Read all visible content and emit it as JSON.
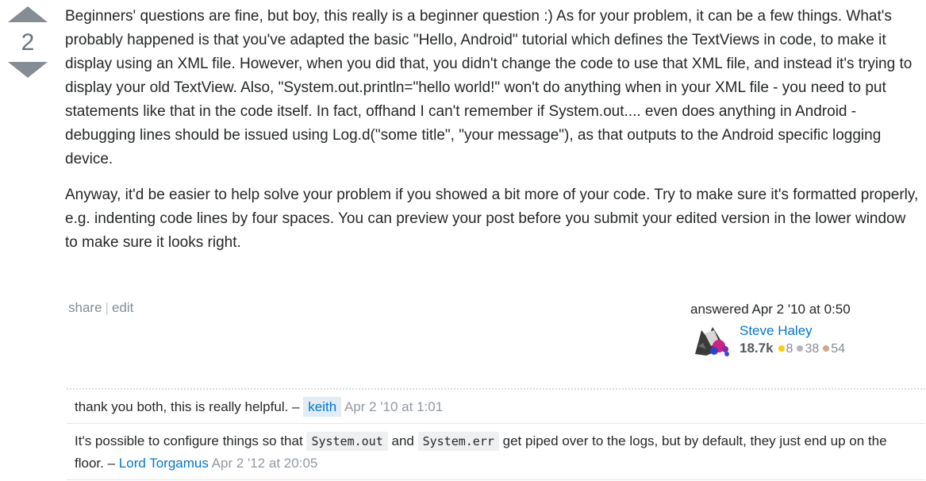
{
  "vote": {
    "count": "2"
  },
  "answer": {
    "paragraphs": [
      "Beginners' questions are fine, but boy, this really is a beginner question :) As for your problem, it can be a few things. What's probably happened is that you've adapted the basic \"Hello, Android\" tutorial which defines the TextViews in code, to make it display using an XML file. However, when you did that, you didn't change the code to use that XML file, and instead it's trying to display your old TextView. Also, \"System.out.println=\"hello world!\" won't do anything when in your XML file - you need to put statements like that in the code itself. In fact, offhand I can't remember if System.out.... even does anything in Android - debugging lines should be issued using Log.d(\"some title\", \"your message\"), as that outputs to the Android specific logging device.",
      "Anyway, it'd be easier to help solve your problem if you showed a bit more of your code. Try to make sure it's formatted properly, e.g. indenting code lines by four spaces. You can preview your post before you submit your edited version in the lower window to make sure it looks right."
    ]
  },
  "post_menu": {
    "share": "share",
    "separator": "|",
    "edit": "edit"
  },
  "user": {
    "action_time": "answered Apr 2 '10 at 0:50",
    "name": "Steve Haley",
    "reputation": "18.7k",
    "gold": "8",
    "silver": "38",
    "bronze": "54"
  },
  "comments": [
    {
      "text": "thank you both, this is really helpful. –",
      "user": "keith",
      "date": "Apr 2 '10 at 1:01"
    },
    {
      "text_1": "It's possible to configure things so that",
      "code_1": "System.out",
      "text_2": "and",
      "code_2": "System.err",
      "text_3": "get piped over to the logs, but by default, they just end up on the floor. –",
      "user": "Lord Torgamus",
      "date": "Apr 2 '12 at 20:05"
    }
  ],
  "colors": {
    "link": "#0077cc",
    "gold": "#ffcc01",
    "silver": "#b4b8bc",
    "bronze": "#d1a684"
  }
}
